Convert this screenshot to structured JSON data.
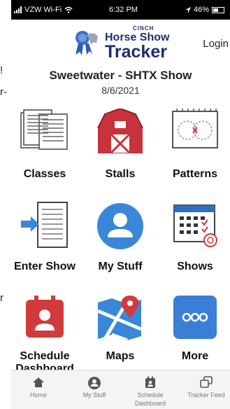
{
  "status_bar": {
    "carrier": "VZW Wi-Fi",
    "time": "6:32 PM",
    "battery": "46%"
  },
  "header": {
    "logo_brand": "CINCH",
    "logo_line1": "Horse Show",
    "logo_line2": "Tracker",
    "login_label": "Login"
  },
  "side_fragments": [
    "!",
    "r-",
    "r"
  ],
  "show": {
    "title": "Sweetwater - SHTX Show",
    "date": "8/6/2021"
  },
  "tiles": [
    {
      "label": "Classes",
      "icon": "classes-document-icon"
    },
    {
      "label": "Stalls",
      "icon": "barn-icon"
    },
    {
      "label": "Patterns",
      "icon": "pattern-icon"
    },
    {
      "label": "Enter Show",
      "icon": "enter-show-icon"
    },
    {
      "label": "My Stuff",
      "icon": "user-icon"
    },
    {
      "label": "Shows",
      "icon": "calendar-icon"
    },
    {
      "label": "Schedule Dashboard",
      "icon": "schedule-dashboard-icon"
    },
    {
      "label": "Maps",
      "icon": "map-icon"
    },
    {
      "label": "More",
      "icon": "more-icon"
    }
  ],
  "tabbar": [
    {
      "label": "Home",
      "icon": "home-icon"
    },
    {
      "label": "My Stuff",
      "icon": "user-icon"
    },
    {
      "label": "Schedule Dashboard",
      "icon": "schedule-dashboard-icon"
    },
    {
      "label": "Tracker Feed",
      "icon": "feed-icon"
    }
  ],
  "colors": {
    "brand_navy": "#1d2f6e",
    "barn_red": "#c8323a",
    "my_stuff_blue": "#3a86d8",
    "more_blue": "#3a7fd5",
    "schedule_red": "#d13b3b"
  }
}
